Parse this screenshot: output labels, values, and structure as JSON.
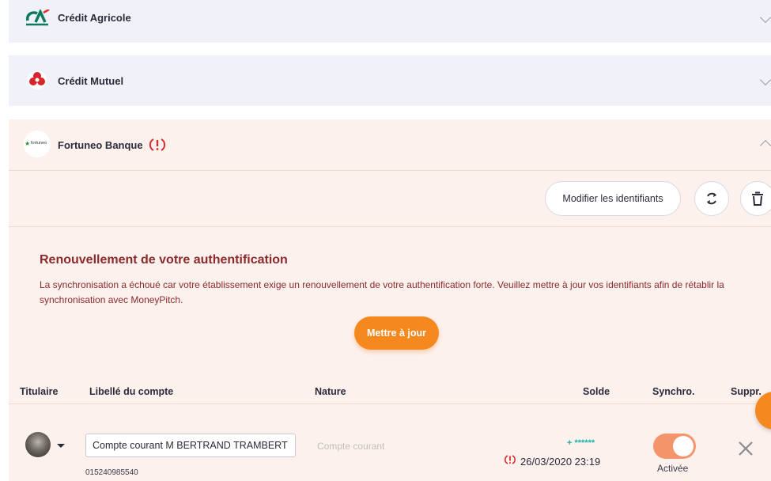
{
  "banks": [
    {
      "name": "Crédit Agricole",
      "expanded": false
    },
    {
      "name": "Crédit Mutuel",
      "expanded": false
    },
    {
      "name": "Fortuneo Banque",
      "expanded": true,
      "logo_text": "fortuneo"
    }
  ],
  "actions": {
    "edit_credentials_label": "Modifier les identifiants"
  },
  "alert": {
    "title": "Renouvellement de votre authentification",
    "message": "La synchronisation a échoué car votre établissement exige un renouvellement de votre authentification forte. Veuillez mettre à jour vos identifiants afin de rétablir la synchronisation avec MoneyPitch.",
    "button_label": "Mettre à jour"
  },
  "table": {
    "headers": {
      "holder": "Titulaire",
      "label": "Libellé du compte",
      "nature": "Nature",
      "balance": "Solde",
      "sync": "Synchro.",
      "delete": "Suppr."
    },
    "rows": [
      {
        "account_label": "Compte courant M BERTRAND TRAMBERT",
        "account_number": "015240985540",
        "nature_placeholder": "Compte courant",
        "balance": "+ ******",
        "sync_date": "26/03/2020 23:19",
        "sync_status": "Activée"
      }
    ]
  },
  "colors": {
    "accent_orange": "#f5891f",
    "alert_red": "#8b2a2a",
    "toggle_on": "#f4946a",
    "balance_teal": "#1bb3a8",
    "error_red": "#d62e2e"
  }
}
